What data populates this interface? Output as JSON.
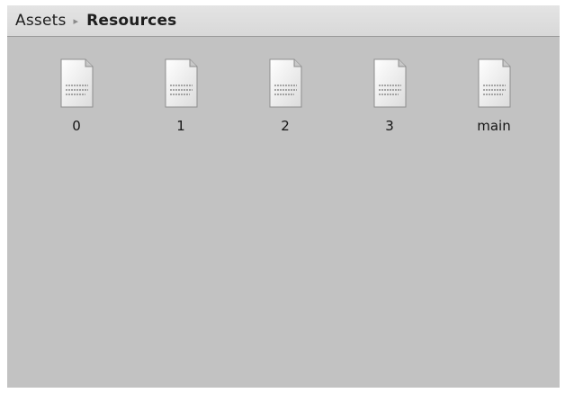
{
  "breadcrumb": {
    "root": "Assets",
    "separator": "▸",
    "current": "Resources"
  },
  "files": [
    {
      "name": "0",
      "icon": "text-file-icon"
    },
    {
      "name": "1",
      "icon": "text-file-icon"
    },
    {
      "name": "2",
      "icon": "text-file-icon"
    },
    {
      "name": "3",
      "icon": "text-file-icon"
    },
    {
      "name": "main",
      "icon": "text-file-icon"
    }
  ]
}
